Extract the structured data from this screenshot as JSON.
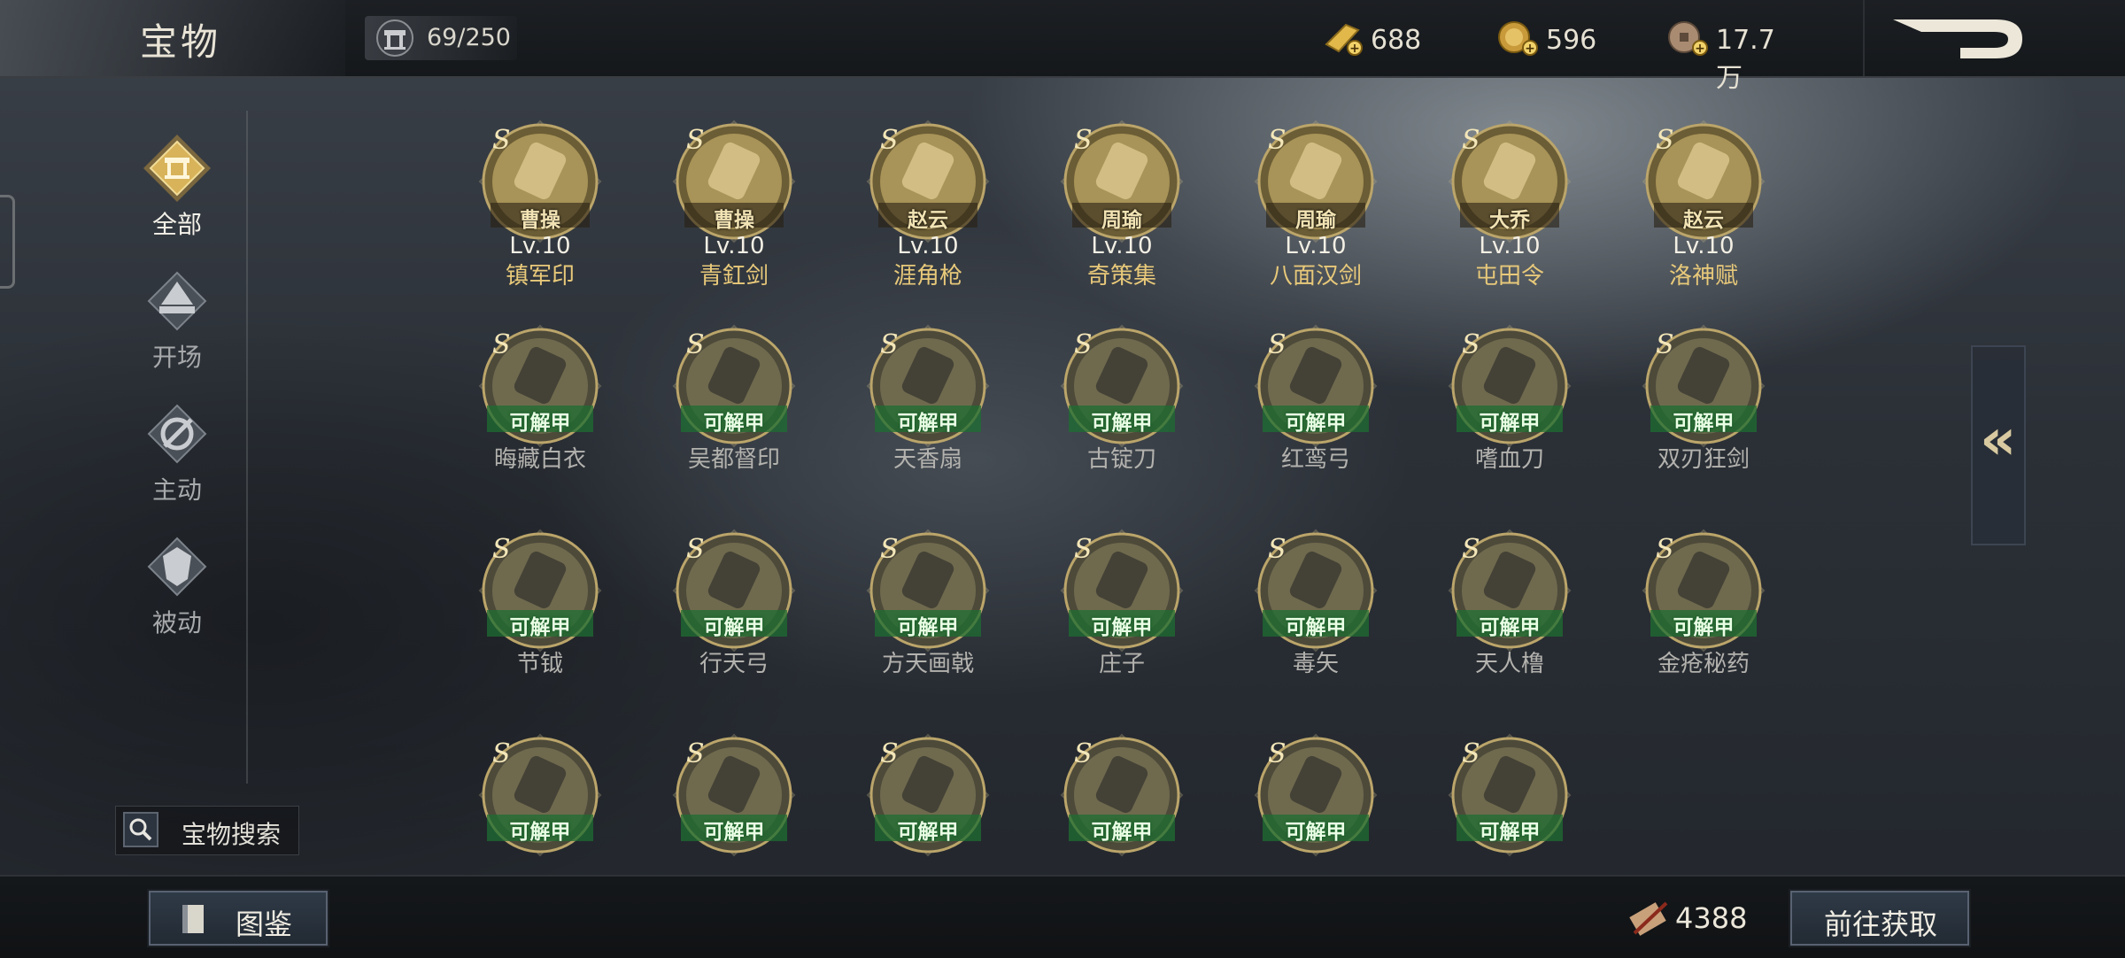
{
  "header": {
    "title": "宝物",
    "capacity": "69/250",
    "currencies": [
      {
        "icon": "gold-bar-icon",
        "value": "688"
      },
      {
        "icon": "gold-coin-icon",
        "value": "596"
      },
      {
        "icon": "copper-coin-icon",
        "value": "17.7万"
      }
    ],
    "back_icon": "back-arrow-icon"
  },
  "sidebar": {
    "items": [
      {
        "label": "全部",
        "icon": "all-icon",
        "active": true
      },
      {
        "label": "开场",
        "icon": "opening-icon",
        "active": false
      },
      {
        "label": "主动",
        "icon": "active-skill-icon",
        "active": false
      },
      {
        "label": "被动",
        "icon": "passive-skill-icon",
        "active": false
      }
    ],
    "search_label": "宝物搜索"
  },
  "grid": {
    "grade": "S",
    "unlock_text": "可解甲",
    "owned": [
      {
        "owner": "曹操",
        "level": "Lv.10",
        "name": "镇军印"
      },
      {
        "owner": "曹操",
        "level": "Lv.10",
        "name": "青釭剑"
      },
      {
        "owner": "赵云",
        "level": "Lv.10",
        "name": "涯角枪"
      },
      {
        "owner": "周瑜",
        "level": "Lv.10",
        "name": "奇策集"
      },
      {
        "owner": "周瑜",
        "level": "Lv.10",
        "name": "八面汉剑"
      },
      {
        "owner": "大乔",
        "level": "Lv.10",
        "name": "屯田令"
      },
      {
        "owner": "赵云",
        "level": "Lv.10",
        "name": "洛神赋"
      }
    ],
    "locked": [
      "晦藏白衣",
      "吴都督印",
      "天香扇",
      "古锭刀",
      "红鸾弓",
      "嗜血刀",
      "双刃狂剑",
      "节钺",
      "行天弓",
      "方天画戟",
      "庄子",
      "毒矢",
      "天人橹",
      "金疮秘药",
      "",
      "",
      "",
      "",
      "",
      ""
    ]
  },
  "collapse_label": "«",
  "footer": {
    "codex_label": "图鉴",
    "token_count": "4388",
    "acquire_label": "前往获取"
  },
  "colors": {
    "accent_gold": "#e8c97a",
    "unlock_green": "#2f9a4a",
    "medallion": "#9c8a55"
  }
}
